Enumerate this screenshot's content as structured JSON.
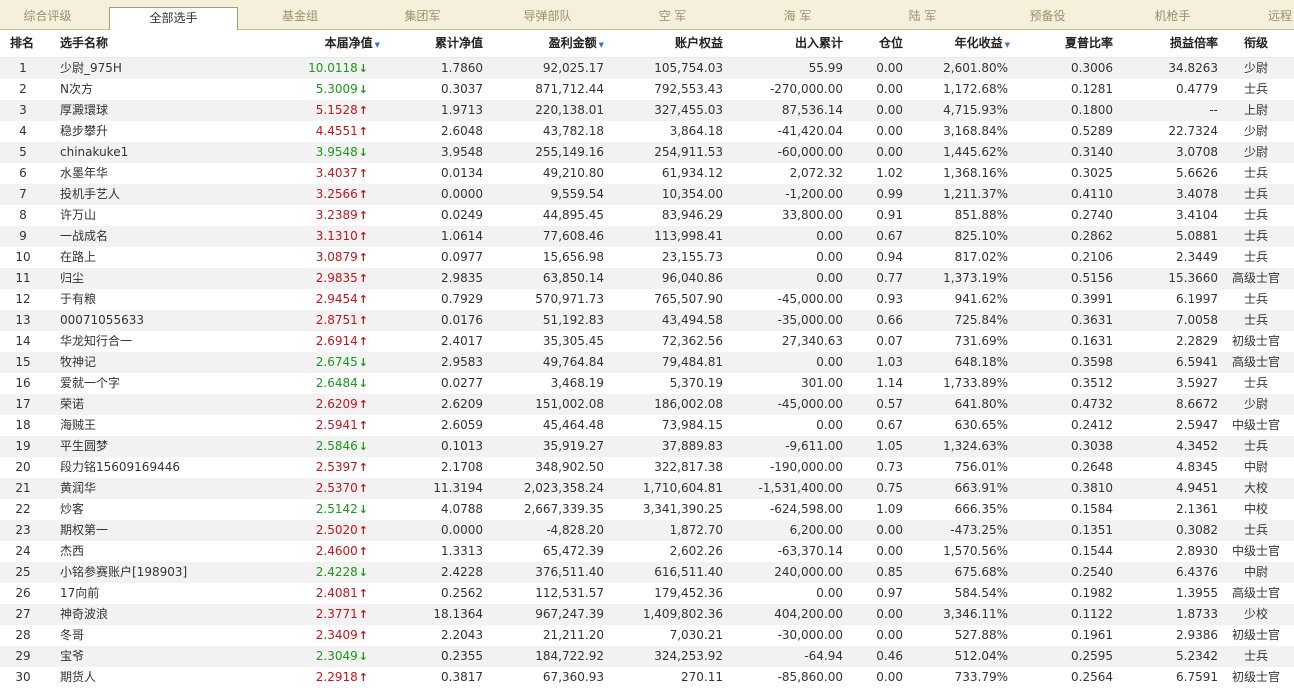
{
  "tabs": [
    "综合评级",
    "全部选手",
    "基金组",
    "集团军",
    "导弹部队",
    "空 军",
    "海 军",
    "陆 军",
    "预备役",
    "机枪手",
    "远程"
  ],
  "active_tab": 1,
  "headers": {
    "rank": "排名",
    "name": "选手名称",
    "nav": "本届净值",
    "cum": "累计净值",
    "profit": "盈利金额",
    "equity": "账户权益",
    "inout": "出入累计",
    "pos": "仓位",
    "annual": "年化收益",
    "sharpe": "夏普比率",
    "ratio": "损益倍率",
    "title": "衔级"
  },
  "sort_icon": "▼",
  "rows": [
    [
      "1",
      "少尉_975H",
      "10.0118",
      "down",
      "1.7860",
      "92,025.17",
      "105,754.03",
      "55.99",
      "0.00",
      "2,601.80%",
      "0.3006",
      "34.8263",
      "少尉"
    ],
    [
      "2",
      "N次方",
      "5.3009",
      "down",
      "0.3037",
      "871,712.44",
      "792,553.43",
      "-270,000.00",
      "0.00",
      "1,172.68%",
      "0.1281",
      "0.4779",
      "士兵"
    ],
    [
      "3",
      "厚澱環球",
      "5.1528",
      "up",
      "1.9713",
      "220,138.01",
      "327,455.03",
      "87,536.14",
      "0.00",
      "4,715.93%",
      "0.1800",
      "--",
      "上尉"
    ],
    [
      "4",
      "稳步攀升",
      "4.4551",
      "up",
      "2.6048",
      "43,782.18",
      "3,864.18",
      "-41,420.04",
      "0.00",
      "3,168.84%",
      "0.5289",
      "22.7324",
      "少尉"
    ],
    [
      "5",
      "chinakuke1",
      "3.9548",
      "down",
      "3.9548",
      "255,149.16",
      "254,911.53",
      "-60,000.00",
      "0.00",
      "1,445.62%",
      "0.3140",
      "3.0708",
      "少尉"
    ],
    [
      "6",
      "水墨年华",
      "3.4037",
      "up",
      "0.0134",
      "49,210.80",
      "61,934.12",
      "2,072.32",
      "1.02",
      "1,368.16%",
      "0.3025",
      "5.6626",
      "士兵"
    ],
    [
      "7",
      "投机手艺人",
      "3.2566",
      "up",
      "0.0000",
      "9,559.54",
      "10,354.00",
      "-1,200.00",
      "0.99",
      "1,211.37%",
      "0.4110",
      "3.4078",
      "士兵"
    ],
    [
      "8",
      "许万山",
      "3.2389",
      "up",
      "0.0249",
      "44,895.45",
      "83,946.29",
      "33,800.00",
      "0.91",
      "851.88%",
      "0.2740",
      "3.4104",
      "士兵"
    ],
    [
      "9",
      "一战成名",
      "3.1310",
      "up",
      "1.0614",
      "77,608.46",
      "113,998.41",
      "0.00",
      "0.67",
      "825.10%",
      "0.2862",
      "5.0881",
      "士兵"
    ],
    [
      "10",
      "在路上",
      "3.0879",
      "up",
      "0.0977",
      "15,656.98",
      "23,155.73",
      "0.00",
      "0.94",
      "817.02%",
      "0.2106",
      "2.3449",
      "士兵"
    ],
    [
      "11",
      "归尘",
      "2.9835",
      "up",
      "2.9835",
      "63,850.14",
      "96,040.86",
      "0.00",
      "0.77",
      "1,373.19%",
      "0.5156",
      "15.3660",
      "高级士官"
    ],
    [
      "12",
      "于有粮",
      "2.9454",
      "up",
      "0.7929",
      "570,971.73",
      "765,507.90",
      "-45,000.00",
      "0.93",
      "941.62%",
      "0.3991",
      "6.1997",
      "士兵"
    ],
    [
      "13",
      "00071055633",
      "2.8751",
      "up",
      "0.0176",
      "51,192.83",
      "43,494.58",
      "-35,000.00",
      "0.66",
      "725.84%",
      "0.3631",
      "7.0058",
      "士兵"
    ],
    [
      "14",
      "华龙知行合一",
      "2.6914",
      "up",
      "2.4017",
      "35,305.45",
      "72,362.56",
      "27,340.63",
      "0.07",
      "731.69%",
      "0.1631",
      "2.2829",
      "初级士官"
    ],
    [
      "15",
      "牧神记",
      "2.6745",
      "down",
      "2.9583",
      "49,764.84",
      "79,484.81",
      "0.00",
      "1.03",
      "648.18%",
      "0.3598",
      "6.5941",
      "高级士官"
    ],
    [
      "16",
      "爱就一个字",
      "2.6484",
      "down",
      "0.0277",
      "3,468.19",
      "5,370.19",
      "301.00",
      "1.14",
      "1,733.89%",
      "0.3512",
      "3.5927",
      "士兵"
    ],
    [
      "17",
      "荣诺",
      "2.6209",
      "up",
      "2.6209",
      "151,002.08",
      "186,002.08",
      "-45,000.00",
      "0.57",
      "641.80%",
      "0.4732",
      "8.6672",
      "少尉"
    ],
    [
      "18",
      "海贼王",
      "2.5941",
      "up",
      "2.6059",
      "45,464.48",
      "73,984.15",
      "0.00",
      "0.67",
      "630.65%",
      "0.2412",
      "2.5947",
      "中级士官"
    ],
    [
      "19",
      "平生圆梦",
      "2.5846",
      "down",
      "0.1013",
      "35,919.27",
      "37,889.83",
      "-9,611.00",
      "1.05",
      "1,324.63%",
      "0.3038",
      "4.3452",
      "士兵"
    ],
    [
      "20",
      "段力铭15609169446",
      "2.5397",
      "up",
      "2.1708",
      "348,902.50",
      "322,817.38",
      "-190,000.00",
      "0.73",
      "756.01%",
      "0.2648",
      "4.8345",
      "中尉"
    ],
    [
      "21",
      "黄润华",
      "2.5370",
      "up",
      "11.3194",
      "2,023,358.24",
      "1,710,604.81",
      "-1,531,400.00",
      "0.75",
      "663.91%",
      "0.3810",
      "4.9451",
      "大校"
    ],
    [
      "22",
      "炒客",
      "2.5142",
      "down",
      "4.0788",
      "2,667,339.35",
      "3,341,390.25",
      "-624,598.00",
      "1.09",
      "666.35%",
      "0.1584",
      "2.1361",
      "中校"
    ],
    [
      "23",
      "期权第一",
      "2.5020",
      "up",
      "0.0000",
      "-4,828.20",
      "1,872.70",
      "6,200.00",
      "0.00",
      "-473.25%",
      "0.1351",
      "0.3082",
      "士兵"
    ],
    [
      "24",
      "杰西",
      "2.4600",
      "up",
      "1.3313",
      "65,472.39",
      "2,602.26",
      "-63,370.14",
      "0.00",
      "1,570.56%",
      "0.1544",
      "2.8930",
      "中级士官"
    ],
    [
      "25",
      "小铭参赛账户[198903]",
      "2.4228",
      "down",
      "2.4228",
      "376,511.40",
      "616,511.40",
      "240,000.00",
      "0.85",
      "675.68%",
      "0.2540",
      "6.4376",
      "中尉"
    ],
    [
      "26",
      "17向前",
      "2.4081",
      "up",
      "0.2562",
      "112,531.57",
      "179,452.36",
      "0.00",
      "0.97",
      "584.54%",
      "0.1982",
      "1.3955",
      "高级士官"
    ],
    [
      "27",
      "神奇波浪",
      "2.3771",
      "up",
      "18.1364",
      "967,247.39",
      "1,409,802.36",
      "404,200.00",
      "0.00",
      "3,346.11%",
      "0.1122",
      "1.8733",
      "少校"
    ],
    [
      "28",
      "冬哥",
      "2.3409",
      "up",
      "2.2043",
      "21,211.20",
      "7,030.21",
      "-30,000.00",
      "0.00",
      "527.88%",
      "0.1961",
      "2.9386",
      "初级士官"
    ],
    [
      "29",
      "宝爷",
      "2.3049",
      "down",
      "0.2355",
      "184,722.92",
      "324,253.92",
      "-64.94",
      "0.46",
      "512.04%",
      "0.2595",
      "5.2342",
      "士兵"
    ],
    [
      "30",
      "期货人",
      "2.2918",
      "up",
      "0.3817",
      "67,360.93",
      "270.11",
      "-85,860.00",
      "0.00",
      "733.79%",
      "0.2564",
      "6.7591",
      "初级士官"
    ]
  ],
  "colors": {
    "up": "#c4161c",
    "down": "#1a9a1a",
    "tabbar": "#f5f0dc",
    "alt_row": "#f2f2f2"
  }
}
